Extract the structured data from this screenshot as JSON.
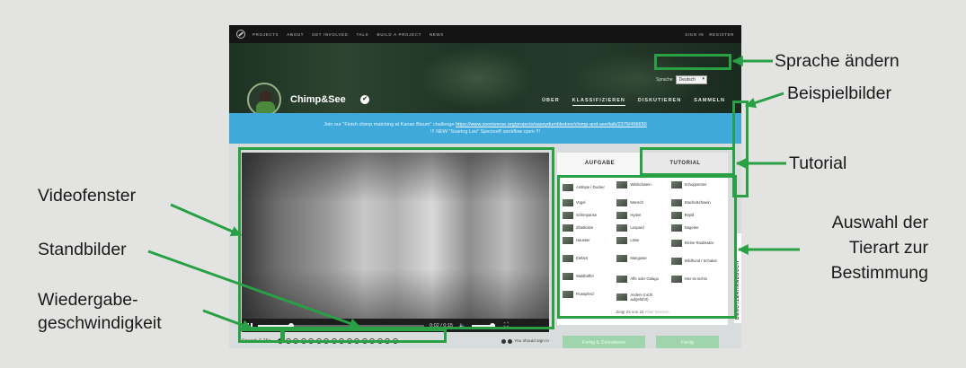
{
  "top_nav": {
    "items": [
      "PROJECTS",
      "ABOUT",
      "GET INVOLVED",
      "TALK",
      "BUILD A PROJECT",
      "NEWS"
    ],
    "sign_in": "SIGN IN",
    "register": "REGISTER"
  },
  "project": {
    "name": "Chimp&See",
    "verified_glyph": "✔",
    "nav": [
      "ÜBER",
      "KLASSIFIZIEREN",
      "DISKUTIEREN",
      "SAMMELN"
    ],
    "active_nav_index": 1
  },
  "language": {
    "label": "Sprache",
    "selected": "Deutsch"
  },
  "banner": {
    "line1_text": "Join our \"Finish chimp matching at Kanan Bisum\" challenge",
    "line1_link": "https://www.zooniverse.org/projects/sassydumbledore/chimp-and-see/talk/2379/456650",
    "line2": "!!! NEW \"Soaring Leo\" Species® workflow open !!!"
  },
  "player": {
    "time": "0:02 / 0:15",
    "progress": 0.2,
    "volume": 1.0,
    "speed_label": "Speed: 0.25x",
    "frame_count": 16,
    "selected_frame": 0,
    "signin_note": "You should sign in"
  },
  "panel": {
    "tab_task": "AUFGABE",
    "tab_tutorial": "TUTORIAL",
    "species": [
      "Antilope / Ducker",
      "Wildschwein",
      "Schuppentier",
      "Vogel",
      "Mensch",
      "Stachelschwein",
      "Schimpanse",
      "Hyäne",
      "Reptil",
      "Zibetkatze",
      "Leopard",
      "Nagetier",
      "Haustier",
      "Löwe",
      "Kleine Raubkatze",
      "Elefant",
      "Manguste",
      "Wildhund / Schakal",
      "Waldbüffel",
      "Affe oder Galago",
      "Hier ist nichts",
      "Flusspferd",
      "Andere (nicht aufgeführt)",
      ""
    ],
    "showing": "Zeigt 24 von 24",
    "clear_filters": "Filter löschen",
    "btn_done_talk": "Fertig & Diskutieren",
    "btn_done": "Fertig"
  },
  "field_guide": {
    "label": "BENUTZERHANDBUCH"
  },
  "annotations": {
    "language": "Sprache ändern",
    "examples": "Beispielbilder",
    "tutorial": "Tutorial",
    "species_line1": "Auswahl der",
    "species_line2": "Tierart zur",
    "species_line3": "Bestimmung",
    "video": "Videofenster",
    "frames": "Standbilder",
    "speed_line1": "Wiedergabe-",
    "speed_line2": "geschwindigkeit"
  },
  "colors": {
    "annotation_green": "#2aa045",
    "banner_blue": "#3fa9dc",
    "done_button": "#9fd4ac"
  }
}
